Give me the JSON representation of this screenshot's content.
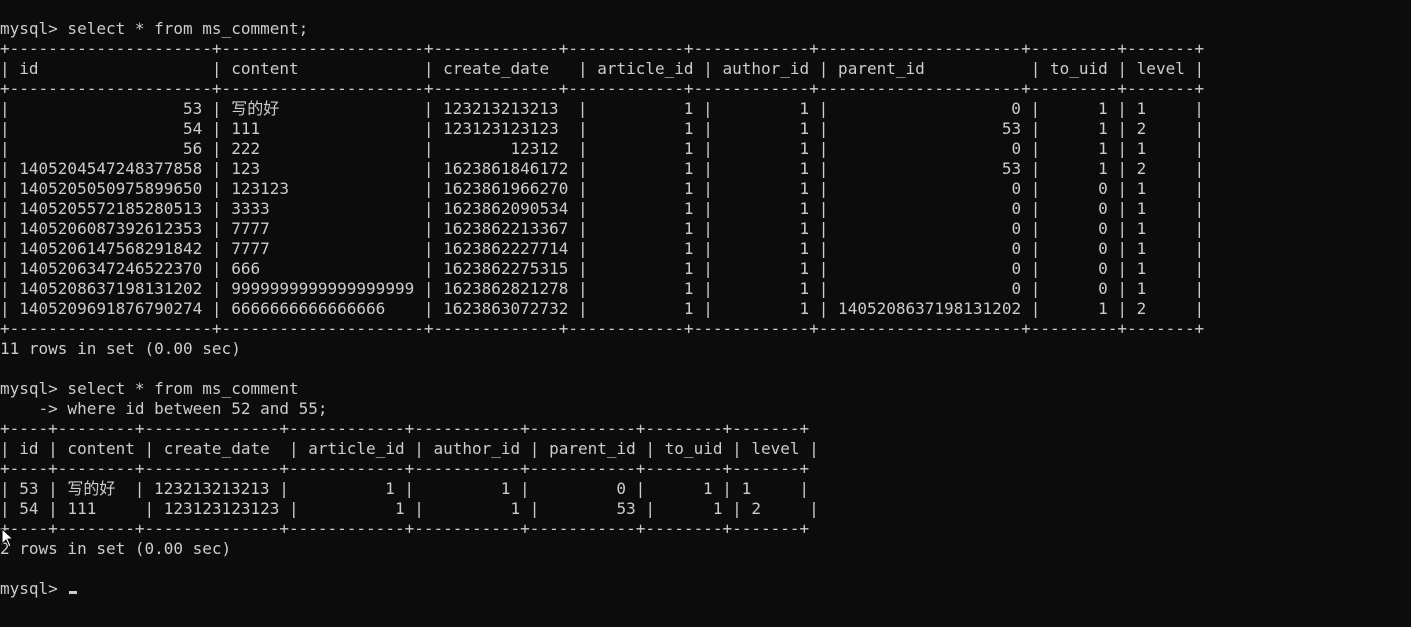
{
  "terminal": {
    "lines": [
      "mysql> select * from ms_comment;",
      "+---------------------+---------------------+-------------+------------+------------+---------------------+---------+-------+",
      "| id                  | content             | create_date   | article_id | author_id | parent_id           | to_uid | level |",
      "+---------------------+---------------------+-------------+------------+------------+---------------------+---------+-------+",
      "|                  53 | 写的好               | 123213213213  |          1 |         1 |                   0 |      1 | 1     |",
      "|                  54 | 111                 | 123123123123  |          1 |         1 |                  53 |      1 | 2     |",
      "|                  56 | 222                 |        12312  |          1 |         1 |                   0 |      1 | 1     |",
      "| 1405204547248377858 | 123                 | 1623861846172 |          1 |         1 |                  53 |      1 | 2     |",
      "| 1405205050975899650 | 123123              | 1623861966270 |          1 |         1 |                   0 |      0 | 1     |",
      "| 1405205572185280513 | 3333                | 1623862090534 |          1 |         1 |                   0 |      0 | 1     |",
      "| 1405206087392612353 | 7777                | 1623862213367 |          1 |         1 |                   0 |      0 | 1     |",
      "| 1405206147568291842 | 7777                | 1623862227714 |          1 |         1 |                   0 |      0 | 1     |",
      "| 1405206347246522370 | 666                 | 1623862275315 |          1 |         1 |                   0 |      0 | 1     |",
      "| 1405208637198131202 | 9999999999999999999 | 1623862821278 |          1 |         1 |                   0 |      0 | 1     |",
      "| 1405209691876790274 | 6666666666666666    | 1623863072732 |          1 |         1 | 1405208637198131202 |      1 | 2     |",
      "+---------------------+---------------------+-------------+------------+------------+---------------------+---------+-------+",
      "11 rows in set (0.00 sec)",
      "",
      "mysql> select * from ms_comment",
      "    -> where id between 52 and 55;",
      "+----+--------+--------------+------------+-----------+-----------+--------+-------+",
      "| id | content | create_date  | article_id | author_id | parent_id | to_uid | level |",
      "+----+--------+--------------+------------+-----------+-----------+--------+-------+",
      "| 53 | 写的好  | 123213213213 |          1 |         1 |         0 |      1 | 1     |",
      "| 54 | 111     | 123123123123 |          1 |         1 |        53 |      1 | 2     |",
      "+----+--------+--------------+------------+-----------+-----------+--------+-------+",
      "2 rows in set (0.00 sec)",
      "",
      "mysql> "
    ]
  }
}
